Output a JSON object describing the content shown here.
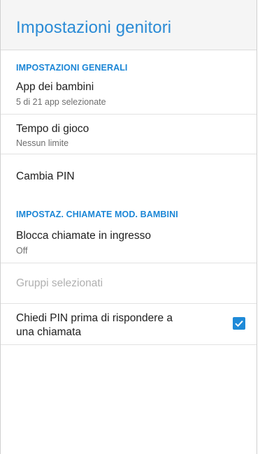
{
  "appbar": {
    "title": "Impostazioni genitori"
  },
  "sections": {
    "general": {
      "header": "IMPOSTAZIONI GENERALI"
    },
    "calls": {
      "header": "IMPOSTAZ. CHIAMATE MOD. BAMBINI"
    }
  },
  "items": {
    "kids_apps": {
      "title": "App dei bambini",
      "summary": "5 di 21 app selezionate"
    },
    "play_time": {
      "title": "Tempo di gioco",
      "summary": "Nessun limite"
    },
    "change_pin": {
      "title": "Cambia PIN"
    },
    "block_calls": {
      "title": "Blocca chiamate in ingresso",
      "summary": "Off"
    },
    "selected_groups": {
      "title": "Gruppi selezionati",
      "enabled": false
    },
    "ask_pin": {
      "title_line1": "Chiedi PIN prima di rispondere a",
      "title_line2": "una chiamata",
      "checked": true
    }
  },
  "colors": {
    "accent": "#2a8bd6",
    "checkbox": "#1f8ad8",
    "appbar_bg": "#f5f5f5",
    "divider": "#e2e2e2"
  }
}
